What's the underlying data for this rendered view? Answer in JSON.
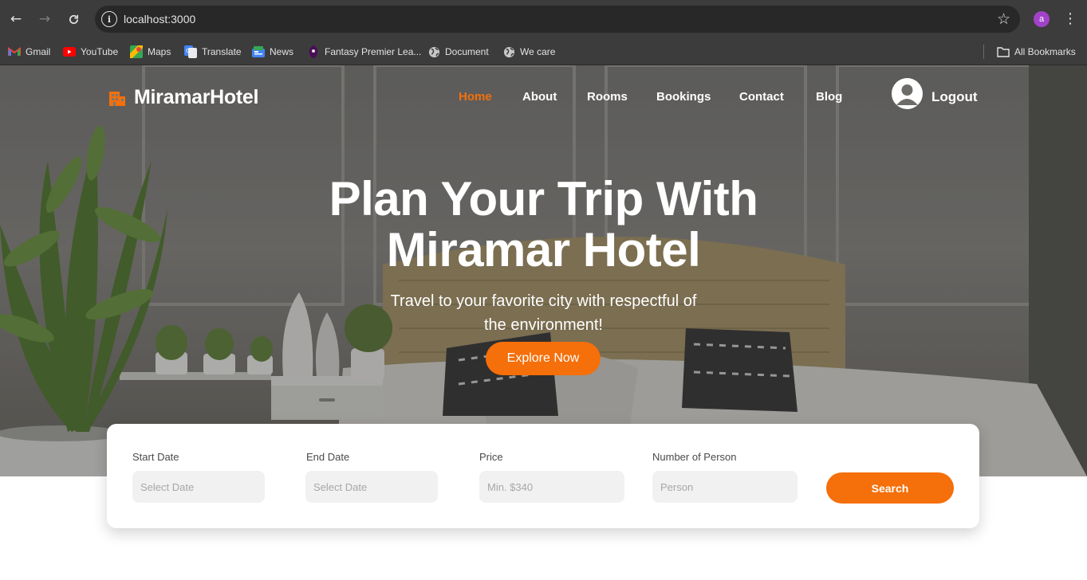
{
  "browser": {
    "url": "localhost:3000",
    "profile_initial": "a",
    "bookmarks": [
      {
        "label": "Gmail",
        "icon": "gmail-icon"
      },
      {
        "label": "YouTube",
        "icon": "youtube-icon"
      },
      {
        "label": "Maps",
        "icon": "maps-icon"
      },
      {
        "label": "Translate",
        "icon": "translate-icon"
      },
      {
        "label": "News",
        "icon": "news-icon"
      },
      {
        "label": "Fantasy Premier Lea...",
        "icon": "premier-league-icon"
      },
      {
        "label": "Document",
        "icon": "globe-icon"
      },
      {
        "label": "We care",
        "icon": "globe-icon"
      }
    ],
    "all_bookmarks_label": "All Bookmarks"
  },
  "site": {
    "brand": "MiramarHotel",
    "nav": [
      {
        "label": "Home",
        "active": true
      },
      {
        "label": "About",
        "active": false
      },
      {
        "label": "Rooms",
        "active": false
      },
      {
        "label": "Bookings",
        "active": false
      },
      {
        "label": "Contact",
        "active": false
      },
      {
        "label": "Blog",
        "active": false
      }
    ],
    "logout_label": "Logout"
  },
  "hero": {
    "title_line1": "Plan Your Trip With",
    "title_line2": "Miramar Hotel",
    "subtitle_line1": "Travel to your favorite city with respectful of",
    "subtitle_line2": "the environment!",
    "cta_label": "Explore Now"
  },
  "search": {
    "fields": [
      {
        "label": "Start Date",
        "placeholder": "Select Date"
      },
      {
        "label": "End Date",
        "placeholder": "Select Date"
      },
      {
        "label": "Price",
        "placeholder": "Min. $340"
      },
      {
        "label": "Number of Person",
        "placeholder": "Person"
      }
    ],
    "button_label": "Search"
  },
  "colors": {
    "accent": "#f56f0a",
    "browser_chrome": "#3c3c3c",
    "omnibox": "#282828",
    "input_bg": "#f1f1f1"
  }
}
